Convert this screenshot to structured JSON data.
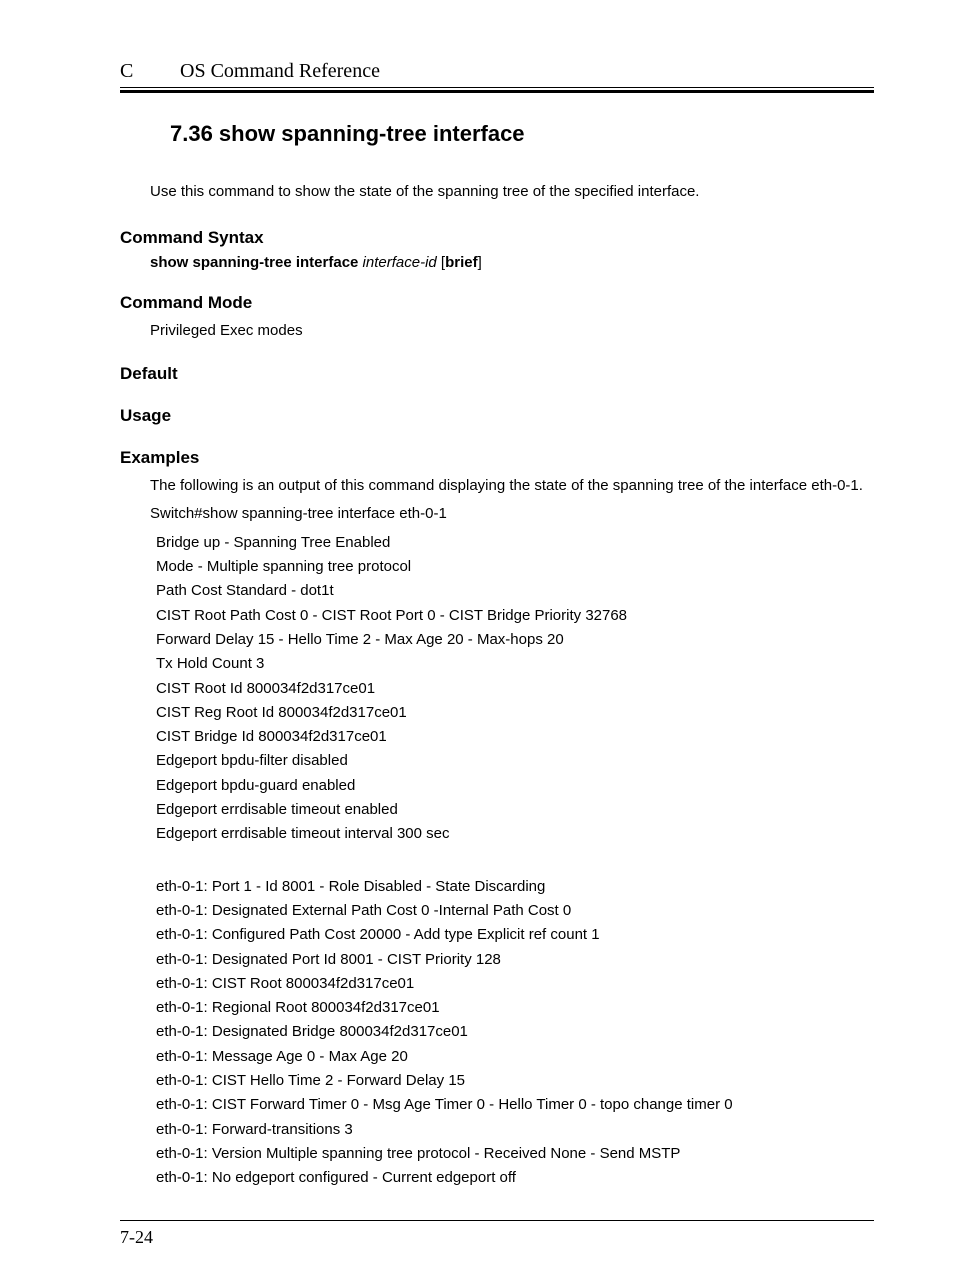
{
  "header": {
    "letter": "C",
    "title": "OS Command Reference"
  },
  "title": "7.36 show spanning-tree interface",
  "intro": "Use this command to show the state of the spanning tree of the specified interface.",
  "sections": {
    "syntax_h": "Command Syntax",
    "syntax": {
      "cmd": "show spanning-tree interface",
      "arg": "interface-id",
      "lb": " [",
      "opt": "brief",
      "rb": "]"
    },
    "mode_h": "Command Mode",
    "mode_body": "Privileged Exec modes",
    "default_h": "Default",
    "usage_h": "Usage",
    "examples_h": "Examples",
    "examples_intro": "The following is an output of this command displaying the state of the spanning tree of the interface eth-0-1.",
    "cmd_line": "Switch#show spanning-tree interface eth-0-1",
    "out1": [
      "Bridge up - Spanning Tree Enabled",
      "Mode - Multiple spanning tree protocol",
      "Path Cost Standard - dot1t",
      "CIST Root Path Cost 0 - CIST Root Port 0 -   CIST Bridge Priority 32768",
      "Forward Delay 15 - Hello Time 2 - Max Age 20 - Max-hops 20",
      "Tx Hold Count 3",
      "CIST Root Id 800034f2d317ce01",
      "CIST Reg Root Id 800034f2d317ce01",
      "CIST Bridge Id 800034f2d317ce01",
      "Edgeport bpdu-filter disabled",
      "Edgeport bpdu-guard enabled",
      "Edgeport errdisable timeout enabled",
      "Edgeport errdisable timeout interval 300 sec"
    ],
    "out2": [
      "eth-0-1: Port 1 - Id 8001 - Role Disabled - State Discarding",
      "eth-0-1: Designated External Path Cost 0 -Internal Path Cost 0",
      "eth-0-1: Configured Path Cost 20000 - Add type Explicit ref count 1",
      "eth-0-1: Designated Port Id 8001 - CIST Priority 128",
      "eth-0-1: CIST Root 800034f2d317ce01",
      "eth-0-1: Regional Root 800034f2d317ce01",
      "eth-0-1: Designated Bridge 800034f2d317ce01",
      "eth-0-1: Message Age 0 - Max Age 20",
      "eth-0-1: CIST Hello Time 2 - Forward Delay 15",
      "eth-0-1: CIST Forward Timer 0 - Msg Age Timer 0 - Hello Timer 0 - topo change timer 0",
      "eth-0-1: Forward-transitions 3",
      "eth-0-1: Version Multiple spanning tree protocol - Received None - Send MSTP",
      "eth-0-1: No edgeport configured - Current edgeport off"
    ]
  },
  "page_num": "7-24"
}
